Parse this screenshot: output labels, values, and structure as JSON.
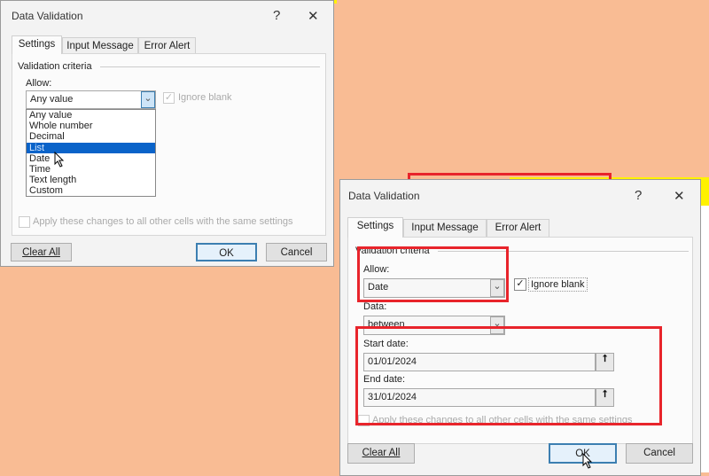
{
  "colors": {
    "background": "#f9bc94",
    "highlight": "#e8242b",
    "selection": "#0a63c9",
    "yellow": "#fff200"
  },
  "dialog1": {
    "title": "Data Validation",
    "help": "?",
    "close": "✕",
    "tabs": [
      "Settings",
      "Input Message",
      "Error Alert"
    ],
    "section": "Validation criteria",
    "allow_label": "Allow:",
    "allow_value": "Any value",
    "ignore_blank": "Ignore blank",
    "options": [
      "Any value",
      "Whole number",
      "Decimal",
      "List",
      "Date",
      "Time",
      "Text length",
      "Custom"
    ],
    "selected_index": 3,
    "apply": "Apply these changes to all other cells with the same settings",
    "buttons": {
      "clear": "Clear All",
      "ok": "OK",
      "cancel": "Cancel"
    }
  },
  "dialog2": {
    "title": "Data Validation",
    "help": "?",
    "close": "✕",
    "tabs": [
      "Settings",
      "Input Message",
      "Error Alert"
    ],
    "section": "Validation criteria",
    "allow_label": "Allow:",
    "allow_value": "Date",
    "ignore_blank": "Ignore blank",
    "ignore_checked": "✓",
    "data_label": "Data:",
    "data_value": "between",
    "start_label": "Start date:",
    "start_value": "01/01/2024",
    "end_label": "End date:",
    "end_value": "31/01/2024",
    "apply": "Apply these changes to all other cells with the same settings",
    "buttons": {
      "clear": "Clear All",
      "ok": "OK",
      "cancel": "Cancel"
    }
  }
}
